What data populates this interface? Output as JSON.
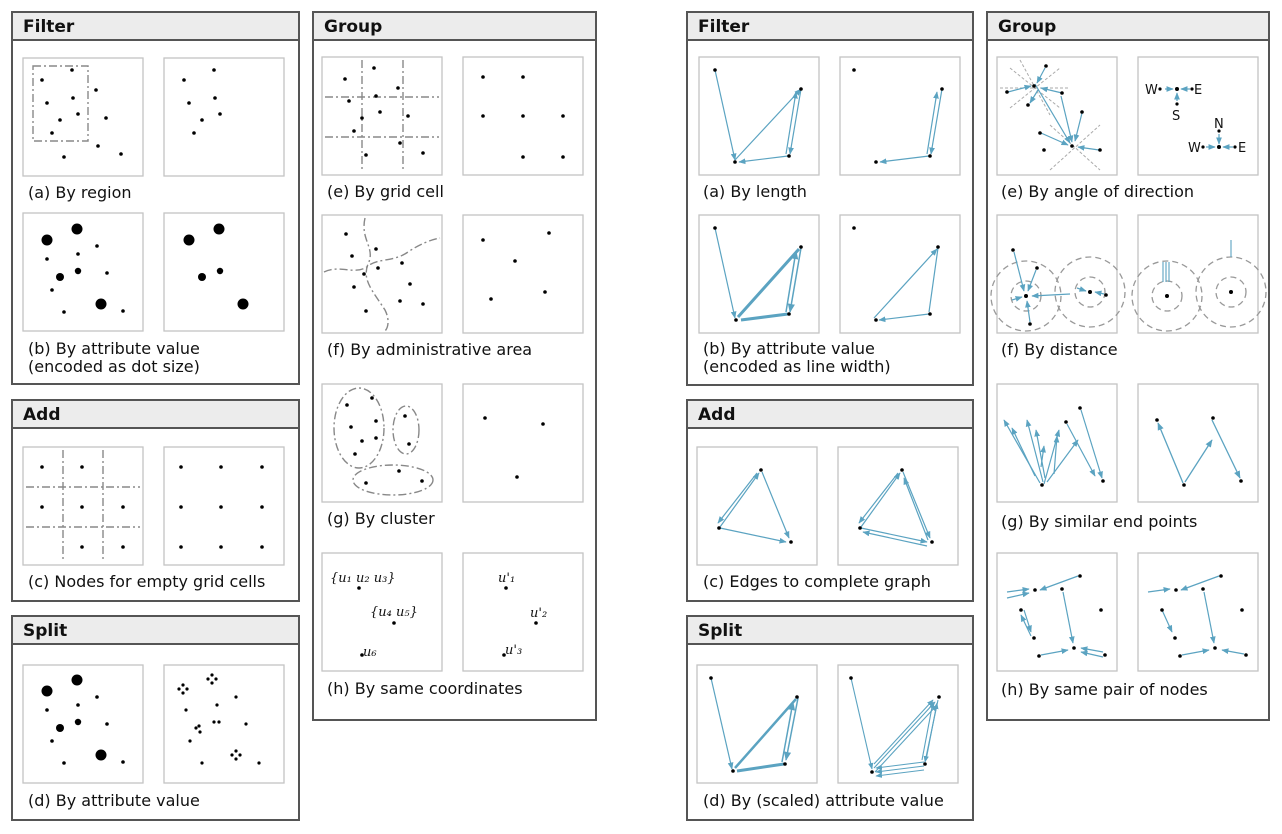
{
  "left_panel": {
    "filter": {
      "title": "Filter",
      "captions": [
        "(a) By region",
        "(b) By attribute value\n(encoded as dot size)"
      ]
    },
    "add": {
      "title": "Add",
      "captions": [
        "(c) Nodes for empty grid cells"
      ]
    },
    "split": {
      "title": "Split",
      "captions": [
        "(d) By attribute value"
      ]
    },
    "group": {
      "title": "Group",
      "captions": [
        "(e) By grid cell",
        "(f) By administrative area",
        "(g) By cluster",
        "(h) By same coordinates"
      ]
    }
  },
  "right_panel": {
    "filter": {
      "title": "Filter",
      "captions": [
        "(a) By length",
        "(b) By attribute value\n(encoded as line width)"
      ]
    },
    "add": {
      "title": "Add",
      "captions": [
        "(c) Edges to complete graph"
      ]
    },
    "split": {
      "title": "Split",
      "captions": [
        "(d) By (scaled) attribute value"
      ]
    },
    "group": {
      "title": "Group",
      "captions": [
        "(e) By angle of direction",
        "(f) By distance",
        "(g) By similar end points",
        "(h) By same pair of nodes"
      ]
    }
  },
  "glyph_labels": {
    "same_coordinates_left": [
      "{u₁ u₂ u₃}",
      "{u₄ u₅}",
      "u₆"
    ],
    "same_coordinates_right": [
      "u'₁",
      "u'₂",
      "u'₃"
    ],
    "compass_left": [
      "W",
      "E",
      "S"
    ],
    "compass_right": [
      "N",
      "W",
      "E"
    ]
  },
  "colors": {
    "edge": "#5ba3c1",
    "border": "#555555",
    "header_bg": "#ececec"
  }
}
